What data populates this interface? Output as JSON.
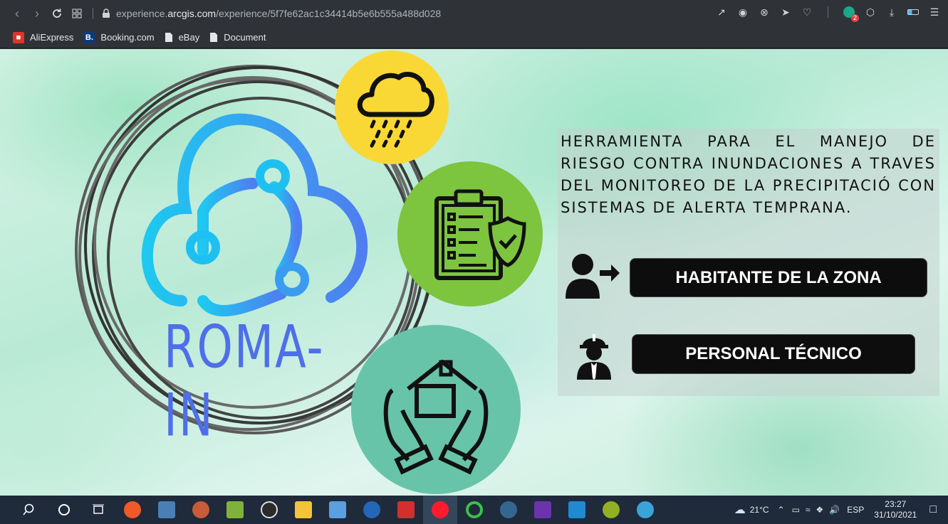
{
  "browser": {
    "url_prefix": "experience.",
    "url_domain": "arcgis.com",
    "url_path": "/experience/5f7fe62ac1c34414b5e6b555a488d028",
    "extension_badge": "2"
  },
  "bookmarks": [
    {
      "label": "AliExpress",
      "icon": "aliexpress-icon",
      "color": "#e43225"
    },
    {
      "label": "Booking.com",
      "icon": "booking-icon",
      "color": "#0c3b7c"
    },
    {
      "label": "eBay",
      "icon": "document-icon",
      "color": "#e3e5e8"
    },
    {
      "label": "Document",
      "icon": "document-icon",
      "color": "#e3e5e8"
    }
  ],
  "app": {
    "logo_text": "ROMA-IN",
    "description": "HERRAMIENTA  PARA EL MANEJO DE RIESGO CONTRA INUNDACIONES A TRAVES DEL MONITOREO DE LA PRECIPITACIÓ CON SISTEMAS DE ALERTA TEMPRANA.",
    "btn_resident": "HABITANTE DE LA ZONA",
    "btn_technical": "PERSONAL TÉCNICO",
    "colors": {
      "rain_circle": "#f9d835",
      "checklist_circle": "#7dc43f",
      "house_circle": "#68c4a8",
      "logo_cloud_start": "#1ec8f0",
      "logo_cloud_end": "#4f7ef0",
      "logo_text": "#4f6fe8"
    }
  },
  "taskbar": {
    "weather": "21°C",
    "lang": "ESP",
    "time": "23:27",
    "date": "31/10/2021"
  }
}
